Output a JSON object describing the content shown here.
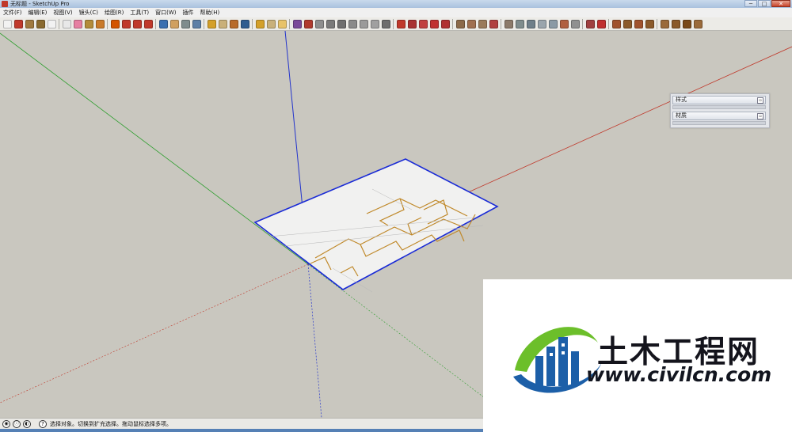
{
  "window": {
    "title": "无标题 - SketchUp Pro",
    "controls": [
      "─",
      "□",
      "✕"
    ]
  },
  "menu": [
    "文件(F)",
    "编辑(E)",
    "视图(V)",
    "镜头(C)",
    "绘图(R)",
    "工具(T)",
    "窗口(W)",
    "插件",
    "帮助(H)"
  ],
  "toolbar": {
    "tools": [
      {
        "icon": "select-icon",
        "color": "#f2f2f2"
      },
      {
        "icon": "pencil-icon",
        "color": "#c0392b"
      },
      {
        "icon": "rectangle-icon",
        "color": "#a17a3f"
      },
      {
        "icon": "circle-icon",
        "color": "#8a6a2f"
      },
      {
        "icon": "arc-icon",
        "color": "#f2f2f2"
      },
      {
        "sep": true
      },
      {
        "icon": "make-component-icon",
        "color": "#e8e8e8"
      },
      {
        "icon": "eraser-icon",
        "color": "#e67fa2"
      },
      {
        "icon": "tape-measure-icon",
        "color": "#b38b3a"
      },
      {
        "icon": "paint-bucket-icon",
        "color": "#c97a2a"
      },
      {
        "sep": true
      },
      {
        "icon": "push-pull-icon",
        "color": "#d35400"
      },
      {
        "icon": "move-icon",
        "color": "#c0392b"
      },
      {
        "icon": "rotate-icon",
        "color": "#c0392b"
      },
      {
        "icon": "offset-icon",
        "color": "#c0392b"
      },
      {
        "sep": true
      },
      {
        "icon": "orbit-icon",
        "color": "#3a6fb0"
      },
      {
        "icon": "pan-icon",
        "color": "#d0a060"
      },
      {
        "icon": "zoom-icon",
        "color": "#7f8c8d"
      },
      {
        "icon": "zoom-extents-icon",
        "color": "#5d7fa6"
      },
      {
        "sep": true
      },
      {
        "icon": "3d-warehouse-icon",
        "color": "#d4a02a"
      },
      {
        "icon": "component-share-icon",
        "color": "#c9b07a"
      },
      {
        "icon": "get-models-icon",
        "color": "#b86b2a"
      },
      {
        "icon": "google-earth-icon",
        "color": "#2f5c8f"
      },
      {
        "sep": true
      },
      {
        "icon": "paint-icon",
        "color": "#d4a02a"
      },
      {
        "icon": "group-icon",
        "color": "#c9b07a"
      },
      {
        "icon": "section-plane-icon",
        "color": "#e8c36a"
      },
      {
        "sep": true
      },
      {
        "icon": "followme-icon",
        "color": "#7b4a9a"
      },
      {
        "icon": "intersect-icon",
        "color": "#b03a2e"
      },
      {
        "icon": "solid-tools-icon",
        "color": "#8e8e8e"
      },
      {
        "icon": "outer-shell-icon",
        "color": "#7a7a7a"
      },
      {
        "icon": "trim-icon",
        "color": "#6f6f6f"
      },
      {
        "icon": "split-icon",
        "color": "#8a8a8a"
      },
      {
        "icon": "union-icon",
        "color": "#9a9a9a"
      },
      {
        "icon": "subtract-icon",
        "color": "#a0a0a0"
      },
      {
        "icon": "stairs-icon",
        "color": "#6e6e6e"
      },
      {
        "sep": true
      },
      {
        "icon": "dimension-icon",
        "color": "#c0392b"
      },
      {
        "icon": "protractor-icon",
        "color": "#a83232"
      },
      {
        "icon": "text-icon",
        "color": "#c04040"
      },
      {
        "icon": "axes-icon",
        "color": "#c03030"
      },
      {
        "icon": "3d-text-icon",
        "color": "#b03030"
      },
      {
        "sep": true
      },
      {
        "icon": "sandbox-contours-icon",
        "color": "#8c6a4a"
      },
      {
        "icon": "sandbox-scratch-icon",
        "color": "#a07050"
      },
      {
        "icon": "smoove-icon",
        "color": "#9a7a5a"
      },
      {
        "icon": "stamp-icon",
        "color": "#b04040"
      },
      {
        "sep": true
      },
      {
        "icon": "x-ray-icon",
        "color": "#8c7a6a"
      },
      {
        "icon": "back-edges-icon",
        "color": "#7f8c8d"
      },
      {
        "icon": "wireframe-icon",
        "color": "#6f7f8a"
      },
      {
        "icon": "hidden-line-icon",
        "color": "#9aa5ad"
      },
      {
        "icon": "shaded-icon",
        "color": "#8a9aa5"
      },
      {
        "icon": "shaded-texture-icon",
        "color": "#b06040"
      },
      {
        "icon": "monochrome-icon",
        "color": "#909090"
      },
      {
        "sep": true
      },
      {
        "icon": "iso-view-icon",
        "color": "#a04040"
      },
      {
        "icon": "top-view-icon",
        "color": "#c03030"
      },
      {
        "sep": true
      },
      {
        "icon": "front-view-icon",
        "color": "#a0522d"
      },
      {
        "icon": "right-view-icon",
        "color": "#8b5a2b"
      },
      {
        "icon": "back-view-icon",
        "color": "#a0522d"
      },
      {
        "icon": "left-view-icon",
        "color": "#8b5a2b"
      },
      {
        "sep": true
      },
      {
        "icon": "bottom-view-icon",
        "color": "#9a6a3a"
      },
      {
        "icon": "perspective-icon",
        "color": "#8a5a2a"
      },
      {
        "icon": "two-point-icon",
        "color": "#7a4a1a"
      },
      {
        "icon": "walk-icon",
        "color": "#9a6a3a"
      }
    ]
  },
  "tray": {
    "panels": [
      {
        "label": "样式"
      },
      {
        "label": "材质"
      }
    ]
  },
  "status": {
    "icons": [
      "geo-location-icon",
      "credits-icon",
      "user-icon"
    ],
    "text": "选择对象。切换到扩充选择。拖动鼠标选择多项。"
  },
  "watermark": {
    "text": "土木工程网",
    "url": "www.civilcn.com",
    "colors": {
      "blue": "#1c5fa8",
      "green": "#6cbf2a",
      "dark": "#14141c"
    }
  },
  "scene": {
    "colors": {
      "red_axis": "#c0392b",
      "green_axis": "#2e9e2e",
      "blue_axis": "#2233cc",
      "image_outline": "#1a2bd6",
      "plan_lines": "#c0892a"
    }
  }
}
